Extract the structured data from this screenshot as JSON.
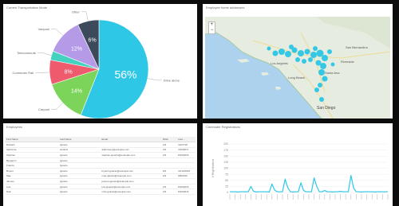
{
  "pie": {
    "title": "Current Transportation Mode",
    "slices": [
      {
        "label": "Drive alone",
        "value": 56,
        "text": "56%",
        "color": "#2ec7e6"
      },
      {
        "label": "Carpool",
        "value": 14,
        "text": "14%",
        "color": "#7dd45a"
      },
      {
        "label": "Commuter Rail",
        "value": 8,
        "text": "8%",
        "color": "#ef5a6d"
      },
      {
        "label": "Telecommute",
        "value": 3,
        "text": "",
        "color": "#45d1c0"
      },
      {
        "label": "Vanpool",
        "value": 12,
        "text": "12%",
        "color": "#b59ae8"
      },
      {
        "label": "Other",
        "value": 7,
        "text": "6%",
        "color": "#3c4a5c"
      }
    ]
  },
  "map": {
    "title": "Employee home addresses",
    "zoom_in": "+",
    "zoom_out": "−",
    "places": [
      "Los Angeles",
      "Long Beach",
      "Santa Ana",
      "San Diego",
      "Riverside",
      "San Bernardino"
    ]
  },
  "table": {
    "title": "Employees",
    "columns": [
      "First Name",
      "Last Name",
      "Email",
      "Work",
      "Last ..."
    ],
    "rows": [
      [
        "Richard",
        "Ignacio",
        "",
        "2/3",
        "10/27/18"
      ],
      [
        "Alphonse",
        "Jenkins",
        "alphonse.j@example.com",
        "3/3",
        "4/15/2017"
      ],
      [
        "Stephen",
        "Ignacio",
        "stephen.ignacio@example.com",
        "2/3",
        "8/15/2016"
      ],
      [
        "Benjamin",
        "Ignacio",
        "",
        "",
        ""
      ],
      [
        "Francis",
        "Ignacio",
        "",
        "",
        ""
      ],
      [
        "Bryant",
        "Ignacio",
        "bryant.ignacio@example.com",
        "9/3",
        "12/13/2016"
      ],
      [
        "Mae",
        "Ignacio",
        "mae.ignacio@example.com",
        "2/3",
        "9/8/2016"
      ],
      [
        "Jannes",
        "Ignacio",
        "jannes.ignacio@example.com",
        "",
        ""
      ],
      [
        "Luis",
        "Ignacio",
        "luis.ignacio@example.com",
        "2/3",
        "8/16/2016"
      ],
      [
        "Nick",
        "Ignacio",
        "nick.ignacio@example.com",
        "2/3",
        "8/15/2016"
      ]
    ]
  },
  "line": {
    "title": "Commuter Registrations",
    "ylabel": "# Registrations",
    "y_ticks": [
      "200",
      "175",
      "150",
      "125",
      "100",
      "75",
      "50",
      "25",
      "0"
    ]
  },
  "chart_data": [
    {
      "type": "pie",
      "title": "Current Transportation Mode",
      "categories": [
        "Drive alone",
        "Carpool",
        "Commuter Rail",
        "Telecommute",
        "Vanpool",
        "Other"
      ],
      "values": [
        56,
        14,
        8,
        3,
        12,
        7
      ]
    },
    {
      "type": "line",
      "title": "Commuter Registrations",
      "ylabel": "# Registrations",
      "ylim": [
        0,
        200
      ],
      "values": [
        3,
        3,
        3,
        2,
        3,
        3,
        3,
        3,
        25,
        5,
        2,
        3,
        3,
        3,
        3,
        2,
        35,
        10,
        3,
        3,
        3,
        55,
        20,
        3,
        2,
        3,
        3,
        40,
        8,
        3,
        3,
        3,
        60,
        25,
        3,
        3,
        8,
        3,
        3,
        2,
        3,
        3,
        5,
        3,
        3,
        3,
        70,
        18,
        3,
        3,
        2,
        3,
        3,
        3,
        3,
        2,
        3,
        3,
        3,
        3,
        3
      ]
    }
  ]
}
